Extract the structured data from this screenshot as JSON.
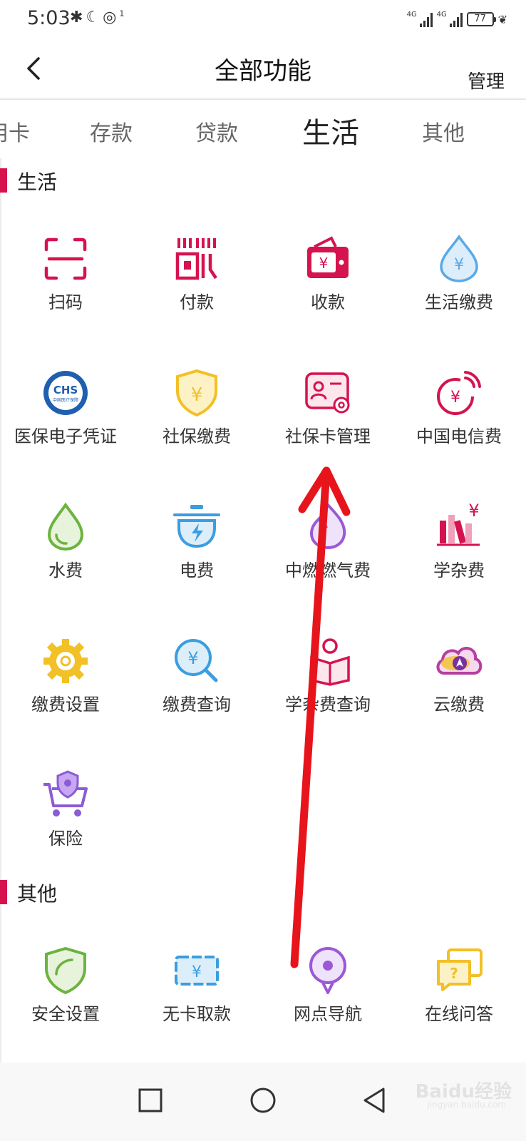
{
  "status_bar": {
    "time": "5:03",
    "icons": [
      "bluetooth-icon",
      "moon-icon",
      "hotspot-icon"
    ],
    "hotspot_count": "1",
    "sim1_label": "4G",
    "sim2_label": "4G",
    "battery": "77"
  },
  "header": {
    "title": "全部功能",
    "manage": "管理"
  },
  "tabs": [
    {
      "label": "用卡"
    },
    {
      "label": "存款"
    },
    {
      "label": "贷款"
    },
    {
      "label": "生活",
      "active": true
    },
    {
      "label": "其他"
    }
  ],
  "sections": [
    {
      "title": "生活",
      "items": [
        {
          "label": "扫码",
          "icon": "scan-icon",
          "color": "#d5134f"
        },
        {
          "label": "付款",
          "icon": "barcode-pay-icon",
          "color": "#d5134f"
        },
        {
          "label": "收款",
          "icon": "wallet-icon",
          "color": "#d5134f"
        },
        {
          "label": "生活缴费",
          "icon": "water-drop-yuan-icon",
          "color": "#5aa9e6"
        },
        {
          "label": "医保电子凭证",
          "icon": "chs-medical-insurance-icon",
          "color": "#1f5fb0",
          "logo_text": "CHS",
          "logo_subtext": "中国医疗保障"
        },
        {
          "label": "社保缴费",
          "icon": "shield-yuan-icon",
          "color": "#f2c027"
        },
        {
          "label": "社保卡管理",
          "icon": "id-card-settings-icon",
          "color": "#d5134f"
        },
        {
          "label": "中国电信费",
          "icon": "telecom-signal-icon",
          "color": "#d5134f"
        },
        {
          "label": "水费",
          "icon": "water-drop-icon",
          "color": "#6cb33f"
        },
        {
          "label": "电费",
          "icon": "electric-pot-icon",
          "color": "#3a9ee0"
        },
        {
          "label": "中燃燃气费",
          "icon": "gas-flame-icon",
          "color": "#9b59d6"
        },
        {
          "label": "学杂费",
          "icon": "books-yuan-icon",
          "color": "#d5134f"
        },
        {
          "label": "缴费设置",
          "icon": "gear-icon",
          "color": "#f2c027"
        },
        {
          "label": "缴费查询",
          "icon": "search-yuan-icon",
          "color": "#3a9ee0"
        },
        {
          "label": "学杂费查询",
          "icon": "reading-person-icon",
          "color": "#d5134f"
        },
        {
          "label": "云缴费",
          "icon": "cloud-arrow-icon",
          "color": "#b53fa0"
        },
        {
          "label": "保险",
          "icon": "cart-shield-icon",
          "color": "#8c5bd6"
        }
      ]
    },
    {
      "title": "其他",
      "items": [
        {
          "label": "安全设置",
          "icon": "security-shield-icon",
          "color": "#6cb33f"
        },
        {
          "label": "无卡取款",
          "icon": "cardless-cash-icon",
          "color": "#3a9ee0"
        },
        {
          "label": "网点导航",
          "icon": "location-pin-icon",
          "color": "#9b59d6"
        },
        {
          "label": "在线问答",
          "icon": "chat-question-icon",
          "color": "#f2c027"
        }
      ]
    }
  ],
  "navbar": {
    "buttons": [
      "recent-apps-icon",
      "home-icon",
      "back-triangle-icon"
    ]
  },
  "watermark": {
    "text": "Baidu经验",
    "subtext": "jingyan.baidu.com"
  },
  "annotation": {
    "arrow_color": "#e8141b"
  }
}
